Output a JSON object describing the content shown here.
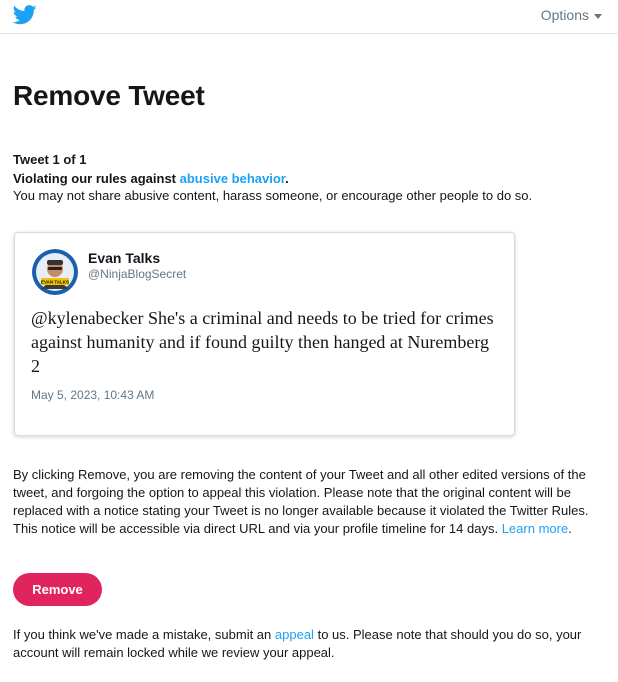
{
  "header": {
    "logo_icon": "twitter-bird-icon",
    "options_label": "Options",
    "options_icon": "caret-down-icon",
    "brand_color": "#1da1f2"
  },
  "main": {
    "title": "Remove Tweet",
    "tweet_count": "Tweet 1 of 1",
    "violation_prefix": "Violating our rules against",
    "violation_link": "abusive behavior",
    "violation_suffix": ".",
    "rule_description": "You may not share abusive content, harass someone, or encourage other people to do so."
  },
  "tweet": {
    "author_name": "Evan Talks",
    "author_handle": "@NinjaBlogSecret",
    "avatar_label": "EVAN TALKS",
    "text": "@kylenabecker She's a criminal and needs to be tried for crimes against humanity and if found guilty then hanged at Nuremberg 2",
    "date": "May 5, 2023, 10:43 AM"
  },
  "explanation": {
    "text": "By clicking Remove, you are removing the content of your Tweet and all other edited versions of the tweet, and forgoing the option to appeal this violation. Please note that the original content will be replaced with a notice stating your Tweet is no longer available because it violated the Twitter Rules. This notice will be accessible via direct URL and via your profile timeline for 14 days.",
    "link": "Learn more",
    "suffix": "."
  },
  "actions": {
    "remove_label": "Remove",
    "remove_color": "#e0245e"
  },
  "appeal": {
    "prefix": "If you think we've made a mistake, submit an",
    "link": "appeal",
    "suffix": "to us. Please note that should you do so, your account will remain locked while we review your appeal."
  }
}
